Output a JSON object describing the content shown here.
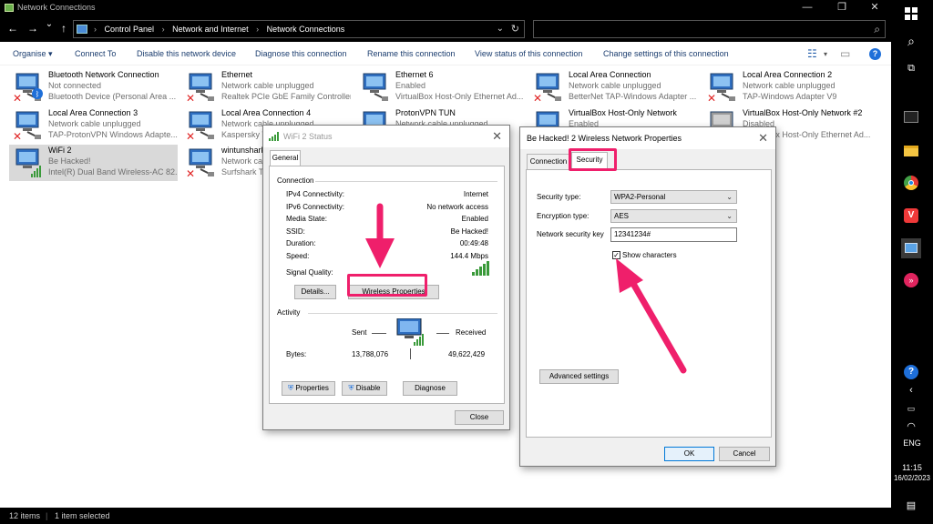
{
  "window": {
    "title": "Network Connections",
    "minimize": "—",
    "maximize": "❐",
    "close": "✕"
  },
  "nav": {
    "back": "←",
    "forward": "→",
    "recent": "⌄",
    "up": "↑"
  },
  "address": {
    "crumbs": [
      "Control Panel",
      "Network and Internet",
      "Network Connections"
    ],
    "separator": "›",
    "dropdown": "⌄",
    "refresh": "↻"
  },
  "search": {
    "placeholder": ""
  },
  "toolbar": {
    "organise": "Organise ▾",
    "connect_to": "Connect To",
    "disable": "Disable this network device",
    "diagnose": "Diagnose this connection",
    "rename": "Rename this connection",
    "view_status": "View status of this connection",
    "change_settings": "Change settings of this connection",
    "help": "?"
  },
  "items": [
    {
      "name": "Bluetooth Network Connection",
      "status": "Not connected",
      "device": "Bluetooth Device (Personal Area ...",
      "icon": "bluetooth-network-icon"
    },
    {
      "name": "Ethernet",
      "status": "Network cable unplugged",
      "device": "Realtek PCIe GbE Family Controller",
      "icon": "ethernet-icon"
    },
    {
      "name": "Ethernet 6",
      "status": "Enabled",
      "device": "VirtualBox Host-Only Ethernet Ad...",
      "icon": "ethernet-icon"
    },
    {
      "name": "Local Area Connection",
      "status": "Network cable unplugged",
      "device": "BetterNet TAP-Windows Adapter ...",
      "icon": "ethernet-icon"
    },
    {
      "name": "Local Area Connection 2",
      "status": "Network cable unplugged",
      "device": "TAP-Windows Adapter V9",
      "icon": "ethernet-icon"
    },
    {
      "name": "Local Area Connection 3",
      "status": "Network cable unplugged",
      "device": "TAP-ProtonVPN Windows Adapte...",
      "icon": "ethernet-icon"
    },
    {
      "name": "Local Area Connection 4",
      "status": "Network cable unplugged",
      "device": "Kaspersky VPN",
      "icon": "ethernet-icon"
    },
    {
      "name": "ProtonVPN TUN",
      "status": "Network cable unplugged",
      "device": "",
      "icon": "ethernet-icon"
    },
    {
      "name": "VirtualBox Host-Only Network",
      "status": "Enabled",
      "device": "",
      "icon": "ethernet-icon"
    },
    {
      "name": "VirtualBox Host-Only Network #2",
      "status": "Disabled",
      "device": "VirtualBox Host-Only Ethernet Ad...",
      "icon": "ethernet-icon"
    },
    {
      "name": "WiFi 2",
      "status": "Be Hacked!",
      "device": "Intel(R) Dual Band Wireless-AC 82...",
      "icon": "wifi-adapter-icon"
    },
    {
      "name": "wintunshark",
      "status": "Network cable unplugged",
      "device": "Surfshark Tunnel",
      "icon": "ethernet-icon"
    }
  ],
  "statusbar": {
    "count": "12 items",
    "selected": "1 item selected"
  },
  "wifi_status": {
    "title": "WiFi 2 Status",
    "tab_general": "General",
    "connection_heading": "Connection",
    "rows": [
      {
        "label": "IPv4 Connectivity:",
        "value": "Internet"
      },
      {
        "label": "IPv6 Connectivity:",
        "value": "No network access"
      },
      {
        "label": "Media State:",
        "value": "Enabled"
      },
      {
        "label": "SSID:",
        "value": "Be Hacked!"
      },
      {
        "label": "Duration:",
        "value": "00:49:48"
      },
      {
        "label": "Speed:",
        "value": "144.4 Mbps"
      }
    ],
    "signal_label": "Signal Quality:",
    "details_btn": "Details...",
    "wireless_props_btn": "Wireless Properties",
    "activity_heading": "Activity",
    "sent_label": "Sent",
    "received_label": "Received",
    "bytes_label": "Bytes:",
    "bytes_sent": "13,788,076",
    "bytes_received": "49,622,429",
    "properties_btn": "Properties",
    "disable_btn": "Disable",
    "diagnose_btn": "Diagnose",
    "close_btn": "Close",
    "signal_bars": 5
  },
  "wireless_props": {
    "title": "Be Hacked! 2 Wireless Network Properties",
    "tab_connection": "Connection",
    "tab_security": "Security",
    "security_type_label": "Security type:",
    "security_type_value": "WPA2-Personal",
    "encryption_label": "Encryption type:",
    "encryption_value": "AES",
    "key_label": "Network security key",
    "key_value": "12341234#",
    "show_chars_label": "Show characters",
    "show_chars_checked": "✓",
    "advanced_btn": "Advanced settings",
    "ok_btn": "OK",
    "cancel_btn": "Cancel"
  },
  "taskbar": {
    "lang": "ENG",
    "time": "11:15",
    "date": "16/02/2023"
  },
  "colors": {
    "highlight": "#ef1f6b",
    "selection": "#d9d9d9",
    "link": "#1a3c6e"
  }
}
